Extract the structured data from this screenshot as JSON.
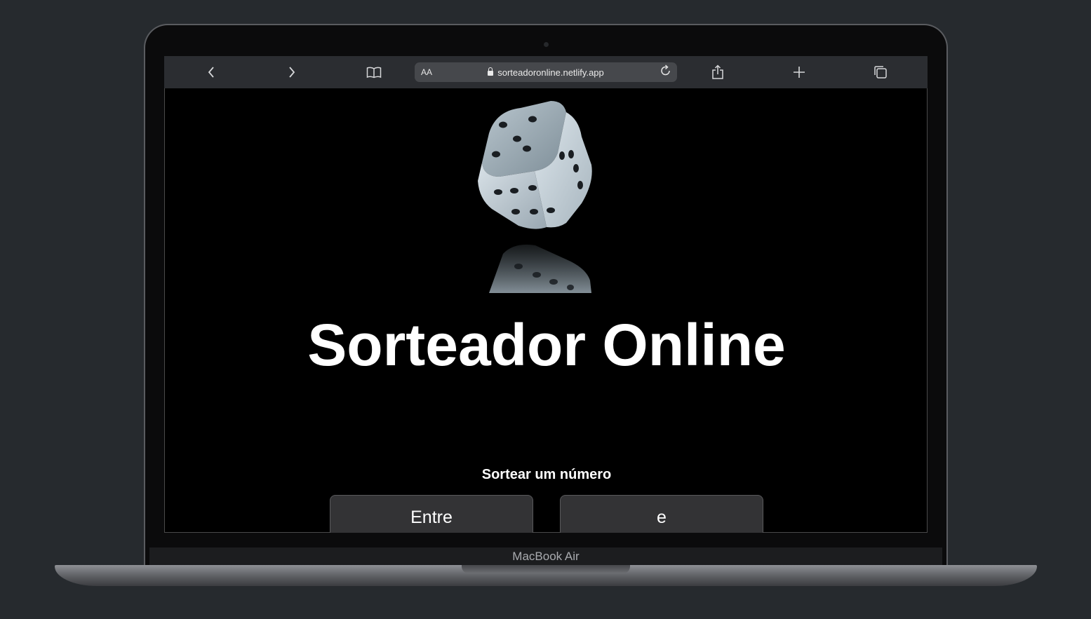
{
  "device": {
    "label": "MacBook Air"
  },
  "browser": {
    "url": "sorteadoronline.netlify.app",
    "text_size_label": "AA",
    "icons": {
      "back": "chevron-left-icon",
      "forward": "chevron-right-icon",
      "bookmarks": "book-icon",
      "reload": "reload-icon",
      "share": "share-icon",
      "new_tab": "plus-icon",
      "tabs": "tabs-icon",
      "lock": "lock-icon"
    }
  },
  "page": {
    "title": "Sorteador Online",
    "subtitle": "Sortear um número",
    "inputs": {
      "from_placeholder": "Entre",
      "to_placeholder": "e"
    },
    "colors": {
      "background": "#000000",
      "text": "#ffffff",
      "input_bg": "#333335"
    }
  }
}
